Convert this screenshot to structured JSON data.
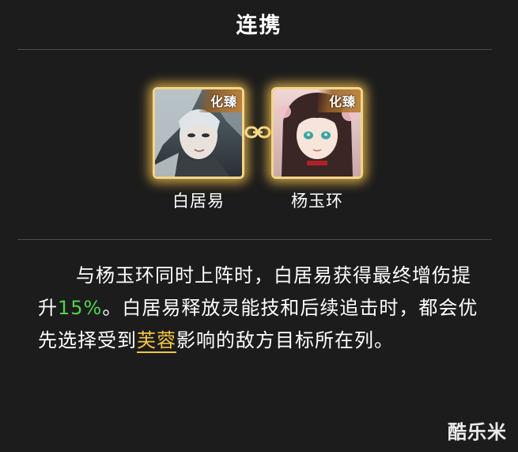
{
  "title": "连携",
  "characters": [
    {
      "name": "白居易",
      "badge": "化臻"
    },
    {
      "name": "杨玉环",
      "badge": "化臻"
    }
  ],
  "description": {
    "part1": "与杨玉环同时上阵时，白居易获得最终增伤提升",
    "percent": "15%",
    "part2": "。白居易释放灵能技和后续追击时，都会优先选择受到",
    "link": "芙蓉",
    "part3": "影响的敌方目标所在列。"
  },
  "watermark": "酷乐米",
  "colors": {
    "card_border": "#f3d58a",
    "highlight_green": "#4fd34f",
    "highlight_link": "#f4c542",
    "background": "#1c1c1c"
  },
  "icons": [
    "chain-link-icon"
  ]
}
